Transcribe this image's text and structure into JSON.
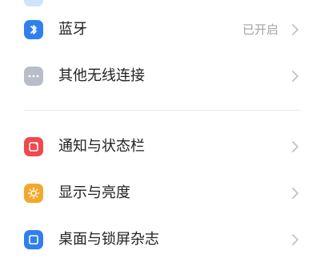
{
  "settings": {
    "items": [
      {
        "label": "蓝牙",
        "value": "已开启",
        "icon": "bluetooth-icon",
        "color": "#2f80ed"
      },
      {
        "label": "其他无线连接",
        "value": "",
        "icon": "more-dots-icon",
        "color": "#b9bdc7"
      },
      {
        "label": "通知与状态栏",
        "value": "",
        "icon": "notification-icon",
        "color": "#f0484e"
      },
      {
        "label": "显示与亮度",
        "value": "",
        "icon": "sun-icon",
        "color": "#f3a82b"
      },
      {
        "label": "桌面与锁屏杂志",
        "value": "",
        "icon": "wallpaper-icon",
        "color": "#2f80ed"
      }
    ]
  }
}
